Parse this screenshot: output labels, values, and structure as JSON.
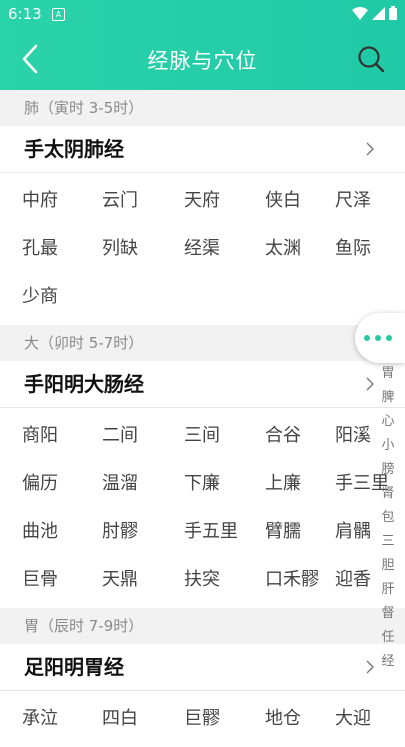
{
  "status_bar": {
    "time": "6:13",
    "notification_badge": "A"
  },
  "app_bar": {
    "title": "经脉与穴位"
  },
  "colors": {
    "accent": "#22cca7",
    "section_bg": "#f2f2f2",
    "fab_dot": "#28c99f"
  },
  "sections": [
    {
      "header": "肺（寅时 3-5时）",
      "meridian": "手太阴肺经",
      "rows": [
        [
          "中府",
          "云门",
          "天府",
          "侠白",
          "尺泽"
        ],
        [
          "孔最",
          "列缺",
          "经渠",
          "太渊",
          "鱼际"
        ],
        [
          "少商"
        ]
      ]
    },
    {
      "header": "大（卯时 5-7时）",
      "meridian": "手阳明大肠经",
      "rows": [
        [
          "商阳",
          "二间",
          "三间",
          "合谷",
          "阳溪"
        ],
        [
          "偏历",
          "温溜",
          "下廉",
          "上廉",
          "手三里"
        ],
        [
          "曲池",
          "肘髎",
          "手五里",
          "臂臑",
          "肩髃"
        ],
        [
          "巨骨",
          "天鼎",
          "扶突",
          "口禾髎",
          "迎香"
        ]
      ]
    },
    {
      "header": "胃（辰时 7-9时）",
      "meridian": "足阳明胃经",
      "rows": [
        [
          "承泣",
          "四白",
          "巨髎",
          "地仓",
          "大迎"
        ]
      ]
    }
  ],
  "side_index": [
    "胃",
    "脾",
    "心",
    "小",
    "膀",
    "肾",
    "包",
    "三",
    "胆",
    "肝",
    "督",
    "任",
    "经"
  ]
}
